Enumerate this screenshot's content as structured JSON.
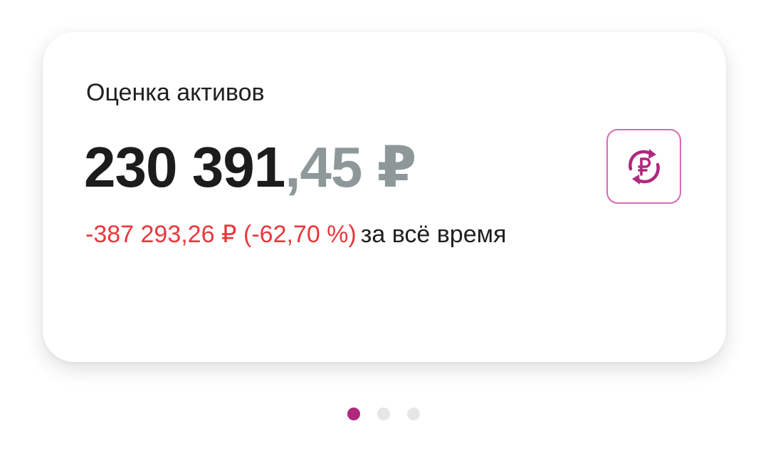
{
  "card": {
    "title": "Оценка активов",
    "amount_integer": "230 391",
    "amount_fraction": ",45 ₽",
    "change_value": "-387 293,26 ₽ (-62,70 %)",
    "change_period": "за всё время"
  },
  "exchange_button": {
    "icon": "currency-exchange-ruble-icon",
    "accent_color": "#b0287e",
    "border_color": "#d86ab4"
  },
  "pagination": {
    "active_index": 0,
    "total": 3,
    "active_color": "#b0287e",
    "inactive_color": "#e6e6e6"
  },
  "colors": {
    "negative": "#e8383d",
    "fraction": "#8e9899",
    "text": "#1c1c1c"
  }
}
